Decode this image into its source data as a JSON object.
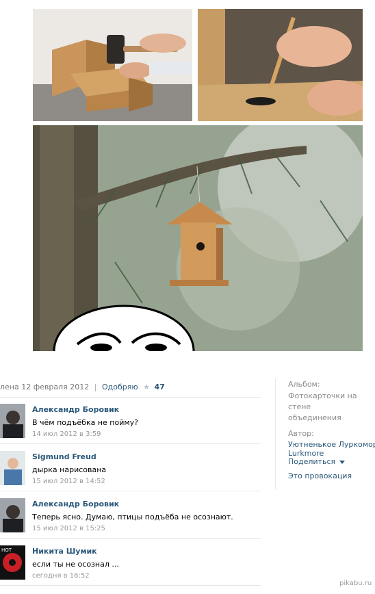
{
  "photo": {
    "alt_hammer": "hands hammering birdhouse",
    "alt_brush": "hand painting hole with brush",
    "alt_tree": "birdhouse hanging on pine branch"
  },
  "post": {
    "date_text": "лена 12 февраля 2012",
    "separator": "|",
    "like_label": "Одобряю",
    "like_icon": "star-icon",
    "like_count": "47"
  },
  "comments": [
    {
      "author": "Александр Боровик",
      "text": "В чём подъёбка не пойму?",
      "time": "14 июл 2012 в 3:59"
    },
    {
      "author": "Sigmund Freud",
      "text": "дырка нарисована",
      "time": "15 июл 2012 в 14:52"
    },
    {
      "author": "Александр Боровик",
      "text": "Теперь ясно. Думаю, птицы подъёба не осознают.",
      "time": "15 июл 2012 в 15:25"
    },
    {
      "author": "Никита Шумик",
      "text": "если ты не осознал ...",
      "time": "сегодня в 16:52"
    }
  ],
  "side": {
    "album_label": "Альбом:",
    "album_value_1": "Фотокарточки на стене",
    "album_value_2": "объединения",
    "author_label": "Автор:",
    "author_value_1": "Уютненькое Луркоморье",
    "author_value_2": "Lurkmore",
    "share_label": "Поделиться",
    "provocation_label": "Это провокация"
  },
  "watermark": "pikabu.ru",
  "colors": {
    "link": "#2b587a",
    "muted": "#8a8a8a",
    "divider": "#e4e8ed"
  }
}
